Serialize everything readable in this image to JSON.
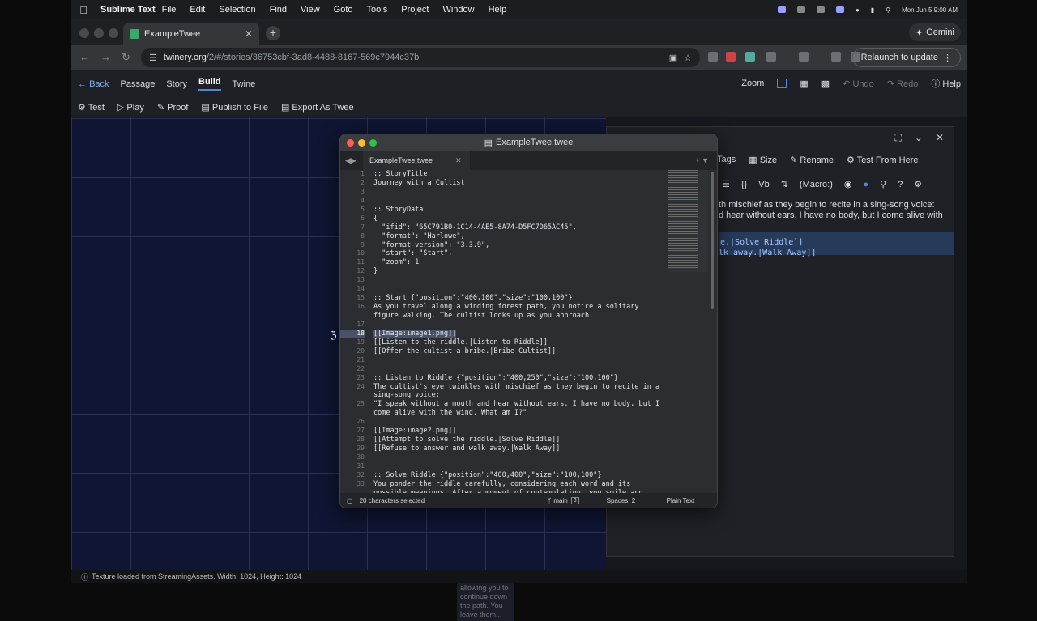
{
  "menubar": {
    "app": "Sublime Text",
    "items": [
      "File",
      "Edit",
      "Selection",
      "Find",
      "View",
      "Goto",
      "Tools",
      "Project",
      "Window",
      "Help"
    ],
    "clock": "Mon Jun 5  9:00 AM"
  },
  "browser": {
    "tab_title": "ExampleTwee",
    "url_host": "twinery.org",
    "url_path": "/2/#/stories/36753cbf-3ad8-4488-8167-569c7944c37b",
    "gemini": "Gemini",
    "relaunch": "Relaunch to update"
  },
  "twine": {
    "nav": {
      "back": "Back",
      "tabs": [
        "Passage",
        "Story",
        "Build",
        "Twine"
      ],
      "active": "Build"
    },
    "actions": [
      "Test",
      "Play",
      "Proof",
      "Publish to File",
      "Export As Twee"
    ],
    "right": {
      "zoom": "Zoom",
      "undo": "Undo",
      "redo": "Redo",
      "help": "Help"
    },
    "passage_hint": "meditation, allowing you to continue down the path. You leave them..."
  },
  "dialog": {
    "actions": [
      "Tags",
      "Size",
      "Rename",
      "Test From Here"
    ],
    "format_macro": "(Macro:)",
    "text1": "th mischief as they begin to recite in a sing-song voice:",
    "text2": "d hear without ears. I have no body, but I come alive with",
    "code1": "e.|Solve Riddle]]",
    "code2": "lk away.|Walk Away]]"
  },
  "sublime": {
    "title": "ExampleTwee.twee",
    "tab": "ExampleTwee.twee",
    "status": {
      "selection": "20 characters selected",
      "branch": "main",
      "branch_count": "3",
      "spaces": "Spaces: 2",
      "syntax": "Plain Text"
    },
    "lines": [
      {
        "n": "1",
        "t": ":: StoryTitle"
      },
      {
        "n": "2",
        "t": "Journey with a Cultist"
      },
      {
        "n": "3",
        "t": ""
      },
      {
        "n": "4",
        "t": ""
      },
      {
        "n": "5",
        "t": ":: StoryData"
      },
      {
        "n": "6",
        "t": "{"
      },
      {
        "n": "7",
        "t": "  \"ifid\": \"65C791B0-1C14-4AE5-8A74-D5FC7D65AC45\","
      },
      {
        "n": "8",
        "t": "  \"format\": \"Harlowe\","
      },
      {
        "n": "9",
        "t": "  \"format-version\": \"3.3.9\","
      },
      {
        "n": "10",
        "t": "  \"start\": \"Start\","
      },
      {
        "n": "11",
        "t": "  \"zoom\": 1"
      },
      {
        "n": "12",
        "t": "}"
      },
      {
        "n": "13",
        "t": ""
      },
      {
        "n": "14",
        "t": ""
      },
      {
        "n": "15",
        "t": ":: Start {\"position\":\"400,100\",\"size\":\"100,100\"}"
      },
      {
        "n": "16",
        "t": "As you travel along a winding forest path, you notice a solitary"
      },
      {
        "n": "",
        "t": "figure walking. The cultist looks up as you approach."
      },
      {
        "n": "17",
        "t": ""
      },
      {
        "n": "18",
        "t": "[[Image:image1.png]]"
      },
      {
        "n": "19",
        "t": "[[Listen to the riddle.|Listen to Riddle]]"
      },
      {
        "n": "20",
        "t": "[[Offer the cultist a bribe.|Bribe Cultist]]"
      },
      {
        "n": "21",
        "t": ""
      },
      {
        "n": "22",
        "t": ""
      },
      {
        "n": "23",
        "t": ":: Listen to Riddle {\"position\":\"400,250\",\"size\":\"100,100\"}"
      },
      {
        "n": "24",
        "t": "The cultist's eye twinkles with mischief as they begin to recite in a"
      },
      {
        "n": "",
        "t": "sing-song voice:"
      },
      {
        "n": "25",
        "t": "\"I speak without a mouth and hear without ears. I have no body, but I"
      },
      {
        "n": "",
        "t": "come alive with the wind. What am I?\""
      },
      {
        "n": "26",
        "t": ""
      },
      {
        "n": "27",
        "t": "[[Image:image2.png]]"
      },
      {
        "n": "28",
        "t": "[[Attempt to solve the riddle.|Solve Riddle]]"
      },
      {
        "n": "29",
        "t": "[[Refuse to answer and walk away.|Walk Away]]"
      },
      {
        "n": "30",
        "t": ""
      },
      {
        "n": "31",
        "t": ""
      },
      {
        "n": "32",
        "t": ":: Solve Riddle {\"position\":\"400,400\",\"size\":\"100,100\"}"
      },
      {
        "n": "33",
        "t": "You ponder the riddle carefully, considering each word and its"
      },
      {
        "n": "",
        "t": "possible meanings. After a moment of contemplation, you smile and"
      }
    ],
    "highlight_line": "18"
  },
  "statusbar": "Texture loaded from StreamingAssets. Width: 1024, Height: 1024"
}
